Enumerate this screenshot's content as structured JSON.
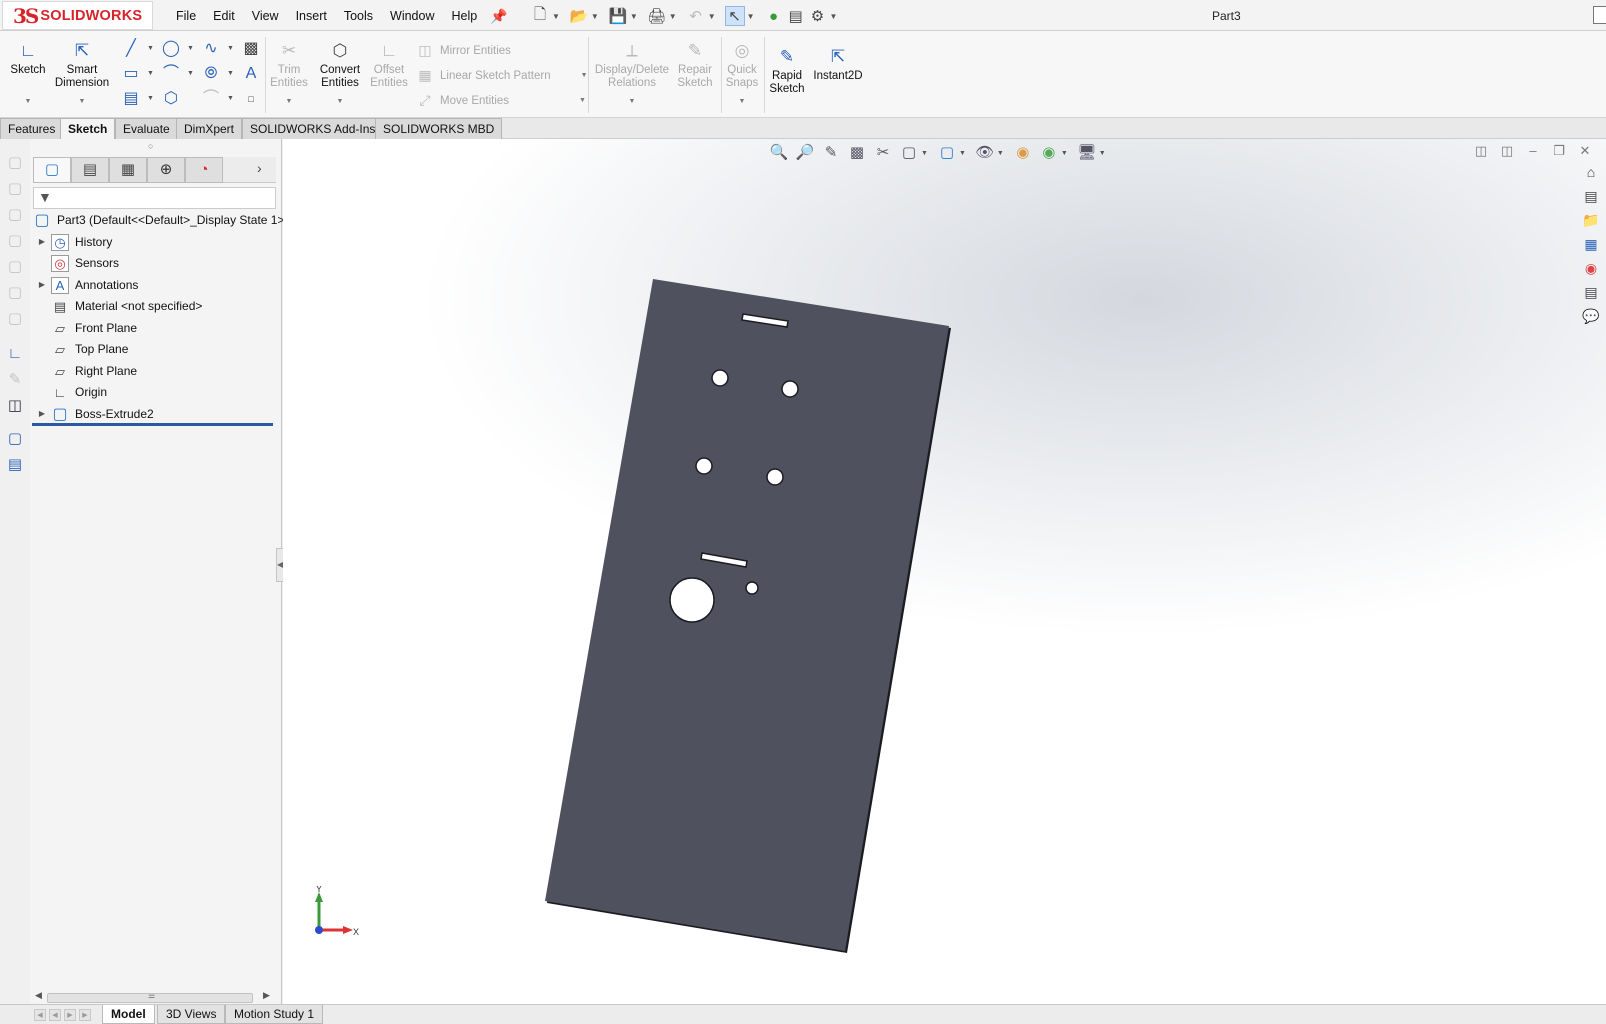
{
  "app": {
    "logo_prefix": "3S",
    "logo_text": "SOLIDWORKS",
    "document_title": "Part3"
  },
  "menu": {
    "items": [
      "File",
      "Edit",
      "View",
      "Insert",
      "Tools",
      "Window",
      "Help"
    ]
  },
  "ribbon": {
    "sketch": "Sketch",
    "smart_dimension_1": "Smart",
    "smart_dimension_2": "Dimension",
    "trim_1": "Trim",
    "trim_2": "Entities",
    "convert_1": "Convert",
    "convert_2": "Entities",
    "offset_1": "Offset",
    "offset_2": "Entities",
    "mirror": "Mirror Entities",
    "linear_pattern": "Linear Sketch Pattern",
    "move": "Move Entities",
    "display_delete_1": "Display/Delete",
    "display_delete_2": "Relations",
    "repair_1": "Repair",
    "repair_2": "Sketch",
    "quick_snaps_1": "Quick",
    "quick_snaps_2": "Snaps",
    "rapid_1": "Rapid",
    "rapid_2": "Sketch",
    "instant2d": "Instant2D"
  },
  "tabs": [
    "Features",
    "Sketch",
    "Evaluate",
    "DimXpert",
    "SOLIDWORKS Add-Ins",
    "SOLIDWORKS MBD"
  ],
  "active_tab": "Sketch",
  "tree": {
    "root": "Part3  (Default<<Default>_Display State 1>",
    "items": [
      {
        "label": "History",
        "expandable": true,
        "icon": "history-icon"
      },
      {
        "label": "Sensors",
        "expandable": false,
        "icon": "sensors-icon"
      },
      {
        "label": "Annotations",
        "expandable": true,
        "icon": "annotations-icon"
      },
      {
        "label": "Material <not specified>",
        "expandable": false,
        "icon": "material-icon"
      },
      {
        "label": "Front Plane",
        "expandable": false,
        "icon": "plane-icon"
      },
      {
        "label": "Top Plane",
        "expandable": false,
        "icon": "plane-icon"
      },
      {
        "label": "Right Plane",
        "expandable": false,
        "icon": "plane-icon"
      },
      {
        "label": "Origin",
        "expandable": false,
        "icon": "origin-icon"
      },
      {
        "label": "Boss-Extrude2",
        "expandable": true,
        "icon": "extrude-icon"
      }
    ]
  },
  "bottom_tabs": [
    "Model",
    "3D Views",
    "Motion Study 1"
  ],
  "active_bottom_tab": "Model",
  "triad": {
    "y_label": "Y",
    "x_label": "X"
  },
  "colors": {
    "accent": "#2a62b8",
    "brand_red": "#d8232a",
    "part_face": "#4f525e",
    "rollback_bar": "#2c5aa0"
  }
}
